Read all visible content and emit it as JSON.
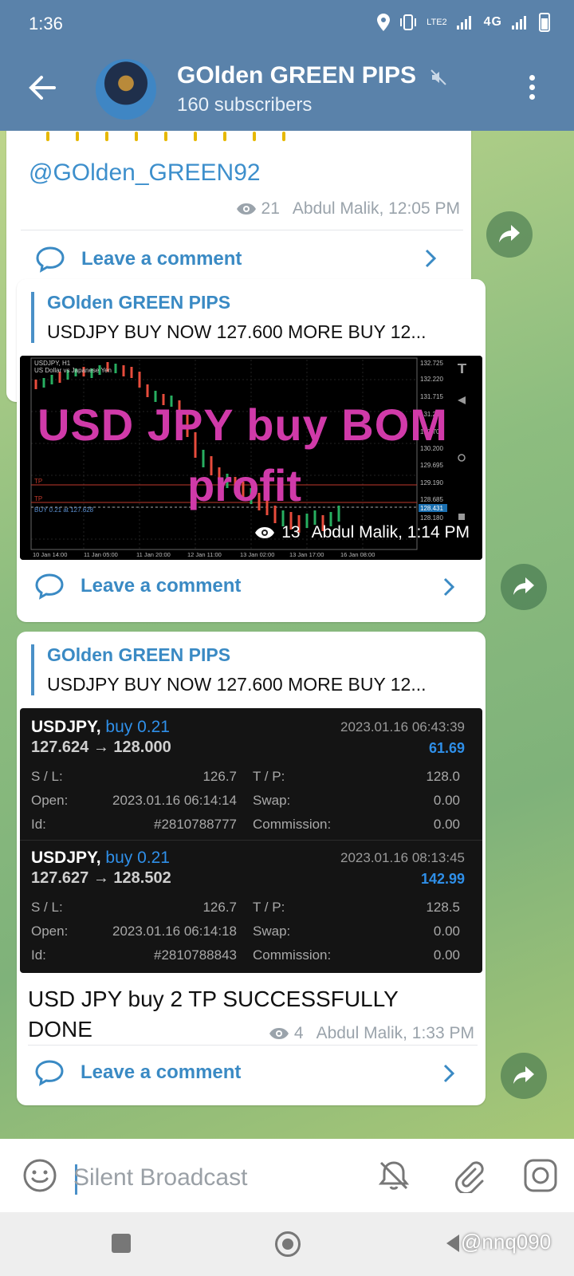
{
  "status_bar": {
    "time": "1:36",
    "network_label": "4G",
    "lte_label": "LTE2"
  },
  "header": {
    "title": "GOlden GREEN PIPS",
    "subtitle": "160 subscribers"
  },
  "messages": [
    {
      "mention": "@GOlden_GREEN92",
      "views": "21",
      "author_time": "Abdul Malik, 12:05 PM",
      "comment_label": "Leave a comment"
    },
    {
      "quote_title": "GOlden GREEN PIPS",
      "quote_text": "USDJPY BUY NOW 127.600 MORE BUY 12...",
      "overlay_line1": "USD JPY buy BOM",
      "overlay_line2": "profit",
      "views": "13",
      "author_time": "Abdul Malik, 1:14 PM",
      "comment_label": "Leave a comment"
    },
    {
      "quote_title": "GOlden GREEN PIPS",
      "quote_text": "USDJPY BUY NOW 127.600 MORE BUY 12...",
      "trades": [
        {
          "symbol": "USDJPY,",
          "side": "buy 0.21",
          "prices": "127.624 → 128.000",
          "date": "2023.01.16 06:43:39",
          "pnl": "61.69",
          "sl_label": "S / L:",
          "sl": "126.7",
          "tp_label": "T / P:",
          "tp": "128.0",
          "open_label": "Open:",
          "open": "2023.01.16 06:14:14",
          "swap_label": "Swap:",
          "swap": "0.00",
          "id_label": "Id:",
          "id": "#2810788777",
          "comm_label": "Commission:",
          "comm": "0.00"
        },
        {
          "symbol": "USDJPY,",
          "side": "buy 0.21",
          "prices": "127.627 → 128.502",
          "date": "2023.01.16 08:13:45",
          "pnl": "142.99",
          "sl_label": "S / L:",
          "sl": "126.7",
          "tp_label": "T / P:",
          "tp": "128.5",
          "open_label": "Open:",
          "open": "2023.01.16 06:14:18",
          "swap_label": "Swap:",
          "swap": "0.00",
          "id_label": "Id:",
          "id": "#2810788843",
          "comm_label": "Commission:",
          "comm": "0.00"
        }
      ],
      "caption": "USD JPY buy 2 TP SUCCESSFULLY DONE",
      "views": "4",
      "author_time": "Abdul Malik, 1:33 PM",
      "comment_label": "Leave a comment"
    }
  ],
  "chart_screenshot": {
    "symbol_label": "USDJPY, H1",
    "desc_label": "US Dollar vs Japanese Yen",
    "order_label": "BUY 0.21 at 127.628",
    "tp_label": "TP",
    "price_ticks": [
      "132.725",
      "132.220",
      "131.715",
      "131.210",
      "130.705",
      "130.200",
      "129.695",
      "129.190",
      "128.685",
      "128.431",
      "128.180"
    ],
    "time_ticks": [
      "10 Jan 14:00",
      "11 Jan 05:00",
      "11 Jan 20:00",
      "12 Jan 11:00",
      "13 Jan 02:00",
      "13 Jan 17:00",
      "16 Jan 08:00"
    ]
  },
  "input_bar": {
    "placeholder": "Silent Broadcast"
  },
  "watermark": "@nnq090",
  "colors": {
    "header": "#5a82aa",
    "link": "#3a8ac4",
    "overlay_text": "#d03aa9",
    "trade_blue": "#2f8fe8"
  },
  "icons": [
    "back-arrow-icon",
    "mute-icon",
    "more-vert-icon",
    "eye-icon",
    "comment-bubble-icon",
    "chevron-right-icon",
    "forward-icon",
    "emoji-icon",
    "bell-off-icon",
    "attach-icon",
    "camera-icon"
  ]
}
